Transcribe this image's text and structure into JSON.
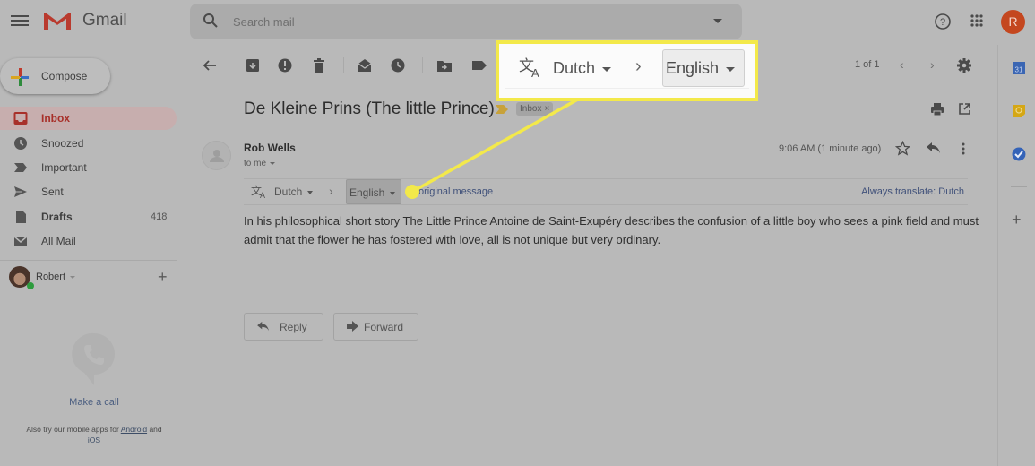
{
  "app": {
    "name": "Gmail",
    "search_placeholder": "Search mail",
    "avatar_initial": "R"
  },
  "sidebar": {
    "compose_label": "Compose",
    "items": [
      {
        "label": "Inbox",
        "icon": "inbox-icon",
        "active": true,
        "count": ""
      },
      {
        "label": "Snoozed",
        "icon": "clock-icon",
        "active": false,
        "count": ""
      },
      {
        "label": "Important",
        "icon": "important-icon",
        "active": false,
        "count": ""
      },
      {
        "label": "Sent",
        "icon": "send-icon",
        "active": false,
        "count": ""
      },
      {
        "label": "Drafts",
        "icon": "draft-icon",
        "active": false,
        "count": "418"
      },
      {
        "label": "All Mail",
        "icon": "mail-icon",
        "active": false,
        "count": ""
      }
    ],
    "account_name": "Robert",
    "make_call": "Make a call",
    "mobile_apps_prefix": "Also try our mobile apps for",
    "android_link": "Android",
    "and_text": "and",
    "ios_link": "iOS"
  },
  "toolbar": {
    "pager": "1 of 1"
  },
  "email": {
    "subject": "De Kleine Prins (The little Prince)",
    "label_chip": "Inbox",
    "sender": "Rob Wells",
    "recipient": "to me",
    "timestamp": "9:06 AM (1 minute ago)",
    "translate": {
      "source_language": "Dutch",
      "target_language": "English",
      "view_original": "View original message",
      "view_original_visible": "w original message",
      "always_translate": "Always translate: Dutch"
    },
    "body": "In his philosophical short story The Little Prince Antoine de Saint-Exupéry describes the confusion of a little boy who sees a pink field and must admit that the flower he has fostered with love, all is not unique but very ordinary.",
    "reply_label": "Reply",
    "forward_label": "Forward"
  },
  "callout": {
    "source_language": "Dutch",
    "target_language": "English",
    "highlight_color": "#f3e94a"
  },
  "colors": {
    "accent_red": "#a8302a",
    "avatar": "#c4471f",
    "link_blue": "#40517a"
  }
}
